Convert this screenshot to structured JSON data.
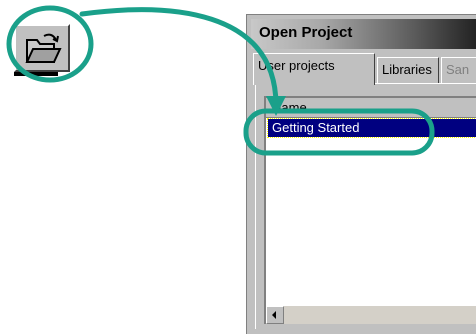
{
  "toolbar": {
    "open_button_icon": "open-folder-icon"
  },
  "dialog": {
    "title": "Open Project",
    "tabs": [
      {
        "label": "User projects",
        "active": true
      },
      {
        "label": "Libraries",
        "active": false
      },
      {
        "label": "San",
        "active": false
      }
    ],
    "list": {
      "column_header": "Name",
      "items": [
        "Getting Started"
      ]
    }
  },
  "annotation": {
    "color": "#1aa08a"
  }
}
